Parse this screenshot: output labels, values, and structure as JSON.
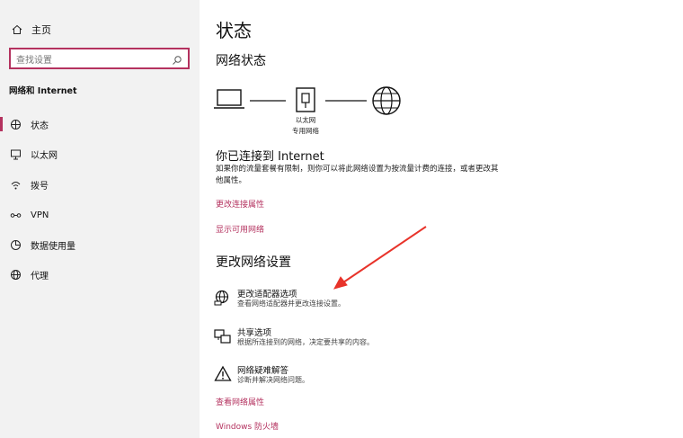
{
  "sidebar": {
    "home_label": "主页",
    "search_placeholder": "查找设置",
    "section_title": "网络和 Internet",
    "items": [
      {
        "label": "状态",
        "icon": "status-icon"
      },
      {
        "label": "以太网",
        "icon": "ethernet-icon"
      },
      {
        "label": "拨号",
        "icon": "dialup-icon"
      },
      {
        "label": "VPN",
        "icon": "vpn-icon"
      },
      {
        "label": "数据使用量",
        "icon": "data-usage-icon"
      },
      {
        "label": "代理",
        "icon": "proxy-icon"
      }
    ]
  },
  "main": {
    "title": "状态",
    "network_status_heading": "网络状态",
    "connection": {
      "line1": "以太网",
      "line2": "专用网络"
    },
    "connected_heading": "你已连接到 Internet",
    "connected_desc": "如果你的流量套餐有限制，则你可以将此网络设置为按流量计费的连接，或者更改其他属性。",
    "links": {
      "change_props": "更改连接属性",
      "show_networks": "显示可用网络",
      "view_props": "查看网络属性",
      "firewall": "Windows 防火墙"
    },
    "change_heading": "更改网络设置",
    "options": [
      {
        "title": "更改适配器选项",
        "subtitle": "查看网络适配器并更改连接设置。",
        "icon": "adapter-icon"
      },
      {
        "title": "共享选项",
        "subtitle": "根据所连接到的网络，决定要共享的内容。",
        "icon": "sharing-icon"
      },
      {
        "title": "网络疑难解答",
        "subtitle": "诊断并解决网络问题。",
        "icon": "warning-icon"
      }
    ]
  },
  "colors": {
    "accent": "#b4325f",
    "arrow": "#e8332a",
    "sidebar_bg": "#f2f2f2"
  }
}
